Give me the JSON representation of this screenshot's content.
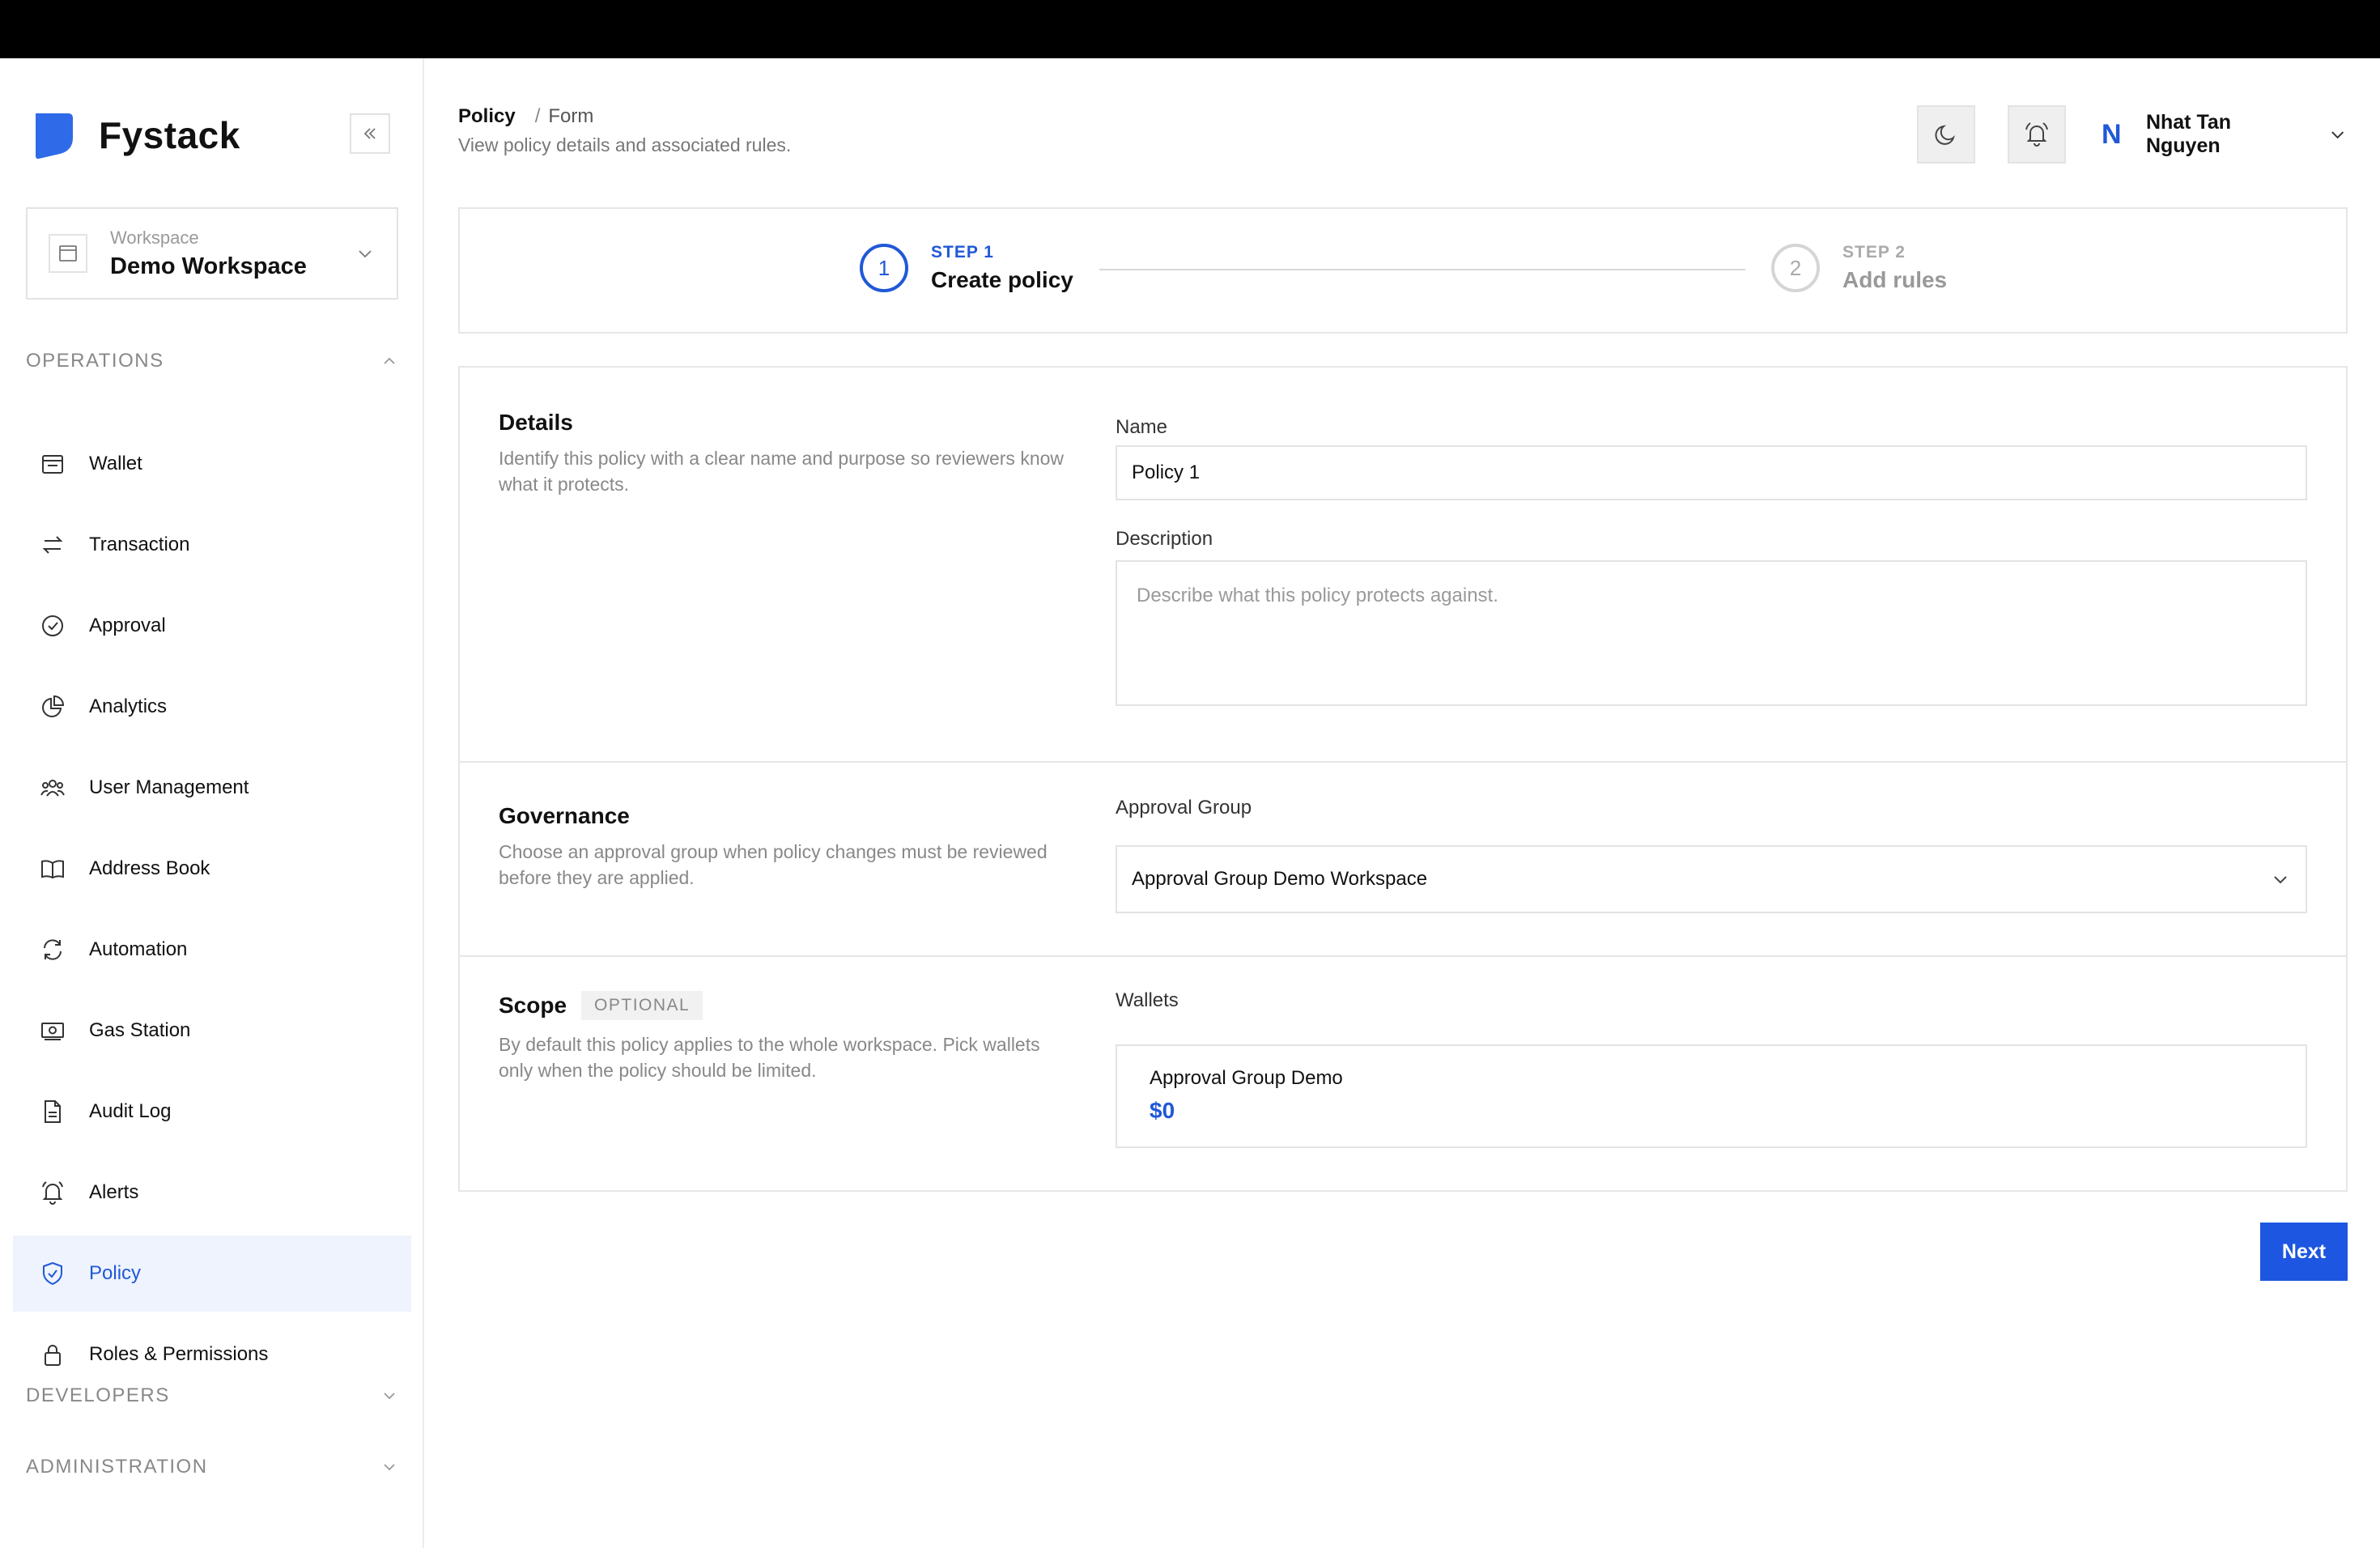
{
  "app": {
    "brand_name": "Fystack",
    "brand_color": "#2f6be8",
    "accent_color": "#2058d8"
  },
  "workspace": {
    "label": "Workspace",
    "name": "Demo Workspace"
  },
  "sidebar": {
    "operations_label": "OPERATIONS",
    "developers_label": "DEVELOPERS",
    "administration_label": "ADMINISTRATION",
    "items": [
      {
        "label": "Wallet",
        "icon": "wallet-icon"
      },
      {
        "label": "Transaction",
        "icon": "arrows-swap-icon"
      },
      {
        "label": "Approval",
        "icon": "check-circle-icon"
      },
      {
        "label": "Analytics",
        "icon": "pie-chart-icon"
      },
      {
        "label": "User Management",
        "icon": "users-icon"
      },
      {
        "label": "Address Book",
        "icon": "book-icon"
      },
      {
        "label": "Automation",
        "icon": "refresh-icon"
      },
      {
        "label": "Gas Station",
        "icon": "cash-icon"
      },
      {
        "label": "Audit Log",
        "icon": "document-icon"
      },
      {
        "label": "Alerts",
        "icon": "bell-icon"
      },
      {
        "label": "Policy",
        "icon": "shield-check-icon",
        "active": true
      },
      {
        "label": "Roles & Permissions",
        "icon": "lock-icon"
      }
    ]
  },
  "header": {
    "breadcrumb_root": "Policy",
    "breadcrumb_sep": "/",
    "breadcrumb_current": "Form",
    "subtitle": "View policy details and associated rules.",
    "user_initial": "N",
    "user_name": "Nhat Tan Nguyen"
  },
  "stepper": {
    "step1_number": "1",
    "step1_label": "STEP 1",
    "step1_title": "Create policy",
    "step2_number": "2",
    "step2_label": "STEP 2",
    "step2_title": "Add rules"
  },
  "details": {
    "title": "Details",
    "description": "Identify this policy with a clear name and purpose so reviewers know what it protects.",
    "name_label": "Name",
    "name_value": "Policy 1",
    "description_label": "Description",
    "description_placeholder": "Describe what this policy protects against."
  },
  "governance": {
    "title": "Governance",
    "description": "Choose an approval group when policy changes must be reviewed before they are applied.",
    "approval_label": "Approval Group",
    "approval_value": "Approval Group Demo Workspace"
  },
  "scope": {
    "title": "Scope",
    "badge": "OPTIONAL",
    "description": "By default this policy applies to the whole workspace. Pick wallets only when the policy should be limited.",
    "wallets_label": "Wallets",
    "wallet_name": "Approval Group Demo",
    "wallet_balance": "$0"
  },
  "actions": {
    "next_label": "Next"
  }
}
